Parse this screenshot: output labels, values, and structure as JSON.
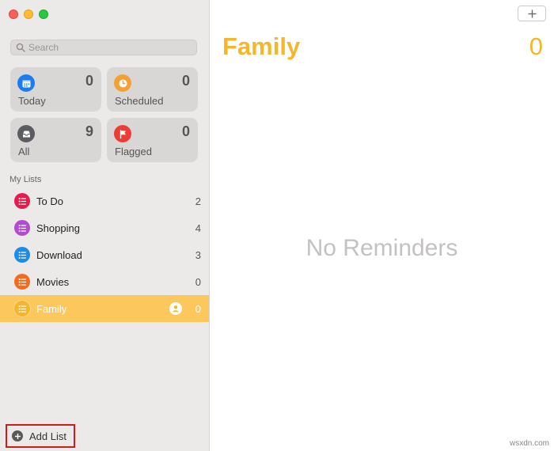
{
  "search": {
    "placeholder": "Search"
  },
  "smart_lists": [
    {
      "label": "Today",
      "count": "0",
      "icon": "calendar-icon",
      "color": "#1a7cf3"
    },
    {
      "label": "Scheduled",
      "count": "0",
      "icon": "clock-icon",
      "color": "#f3a134"
    },
    {
      "label": "All",
      "count": "9",
      "icon": "tray-icon",
      "color": "#5b5d62"
    },
    {
      "label": "Flagged",
      "count": "0",
      "icon": "flag-icon",
      "color": "#ee3b33"
    }
  ],
  "my_lists": {
    "title": "My Lists",
    "items": [
      {
        "name": "To Do",
        "count": "2",
        "color": "#e8194d"
      },
      {
        "name": "Shopping",
        "count": "4",
        "color": "#b34bd2"
      },
      {
        "name": "Download",
        "count": "3",
        "color": "#1c8ce8"
      },
      {
        "name": "Movies",
        "count": "0",
        "color": "#f06d1d"
      },
      {
        "name": "Family",
        "count": "0",
        "color": "#f5b62a",
        "selected": true,
        "shared": true
      }
    ]
  },
  "add_list": {
    "label": "Add List"
  },
  "main": {
    "title": "Family",
    "total": "0",
    "empty_message": "No Reminders",
    "accent": "#f5b62a"
  },
  "watermark": "wsxdn.com"
}
